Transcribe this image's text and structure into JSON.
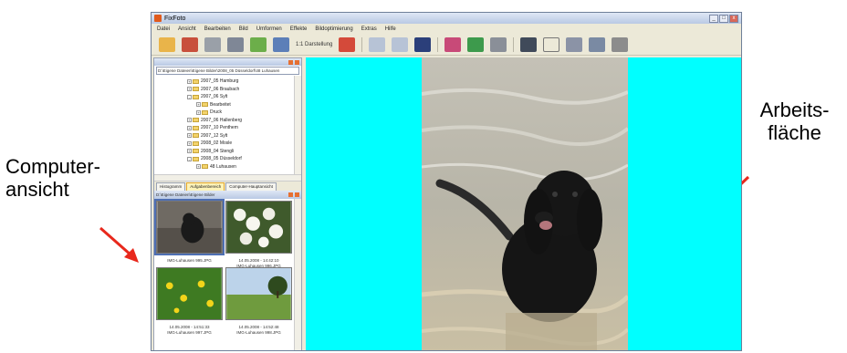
{
  "annotations": {
    "left_line1": "Computer-",
    "left_line2": "ansicht",
    "right_line1": "Arbeits-",
    "right_line2": "fläche"
  },
  "window": {
    "title": "FixFoto",
    "buttons": [
      "_",
      "□",
      "x"
    ]
  },
  "menu": [
    "Datei",
    "Ansicht",
    "Bearbeiten",
    "Bild",
    "Umformen",
    "Effekte",
    "Bildoptimierung",
    "Extras",
    "Hilfe"
  ],
  "toolbar": {
    "zoom_label": "1:1 Darstellung"
  },
  "folder_panel": {
    "path": "D:\\Eigene Dateien\\Eigene Bilder\\2008_05 Düsseldorf\\48 Luhausen",
    "tree": [
      {
        "label": "2007_05 Hamburg",
        "expanded": false
      },
      {
        "label": "2007_06 Braubach",
        "expanded": false
      },
      {
        "label": "2007_06 Sylt",
        "expanded": true
      },
      {
        "label": "Bearbeitet",
        "expanded": false
      },
      {
        "label": "Druck",
        "expanded": false
      },
      {
        "label": "2007_06 Hallenberg",
        "expanded": false
      },
      {
        "label": "2007_10 Penthem",
        "expanded": false
      },
      {
        "label": "2007_12 Sylt",
        "expanded": false
      },
      {
        "label": "2008_02 Mosle",
        "expanded": false
      },
      {
        "label": "2008_04 Stengli",
        "expanded": false
      },
      {
        "label": "2008_05 Düsseldorf",
        "expanded": true
      },
      {
        "label": "48 Luhausen",
        "expanded": false
      }
    ]
  },
  "tabs": [
    "Histogramm",
    "Aufgabenbereich",
    "Computer-Hauptansicht"
  ],
  "thumb_panel": {
    "header": "D:\\Eigene Dateien\\Eigene Bilder"
  },
  "thumbs": [
    {
      "cap1": "",
      "cap2": "IMG-Luhausen 995.JPG",
      "selected": true
    },
    {
      "cap1": "14.05.2008 - 14:42:10",
      "cap2": "IMG-Luhausen 996.JPG",
      "selected": false
    },
    {
      "cap1": "14.05.2008 - 14:51:33",
      "cap2": "IMG-Luhausen 997.JPG",
      "selected": false
    },
    {
      "cap1": "14.05.2008 - 14:52:48",
      "cap2": "IMG-Luhausen 998.JPG",
      "selected": false
    }
  ],
  "colors": {
    "workspace_bg": "#00ffff",
    "arrow": "#e8281c"
  }
}
